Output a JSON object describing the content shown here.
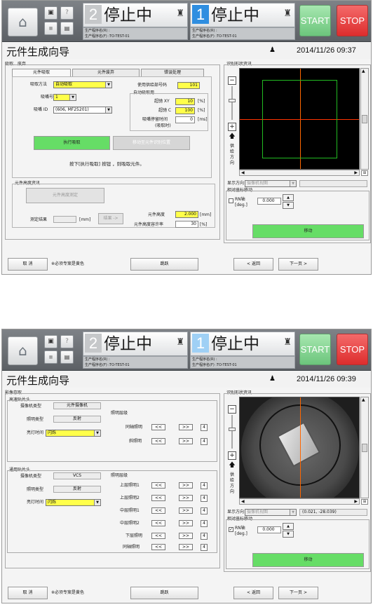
{
  "screens": [
    {
      "header": {
        "home_icon": "home-icon",
        "lane1": {
          "number": "2",
          "status": "停止中",
          "prog1": "生产程序名(R) :",
          "prog2": "生产程序名(F) :TO-TEST-01"
        },
        "lane2": {
          "number": "1",
          "status": "停止中",
          "prog1": "生产程序名(R) :",
          "prog2": "生产程序名(F) :TO-TEST-01"
        },
        "start": "START",
        "stop": "STOP",
        "colors": {
          "start": "#6cc57c",
          "stop": "#dd2d2d",
          "lane_active": "#2f8ee0"
        }
      },
      "title": "元件生成向导",
      "datetime": "2014/11/26 09:37",
      "group_title": "吸取、废弃",
      "tabs": [
        "元件吸取",
        "元件废弃",
        "错误处理"
      ],
      "pick_method_label": "吸取方法",
      "pick_method_value": "自动吸取",
      "nozzle_label": "吸嘴号",
      "nozzle_value": "1",
      "nozzle_id_label": "吸嘴 ID",
      "nozzle_id_value": "(606, MF25201)",
      "feeder_label": "使用供给部号码",
      "feeder_value": "101",
      "auto_label": "自动吸取用",
      "xy_label": "超驰 XY",
      "xy_value": "10",
      "xy_unit": "[%]",
      "c_label": "超驰 C",
      "c_value": "100",
      "c_unit": "[%]",
      "stop_label": "吸嘴停留时间",
      "stop_value": "0",
      "stop_unit": "[ms]",
      "stop_label2": "(吸取时)",
      "exec_button": "执行吸取",
      "move_button": "移动至元件识别位置",
      "hint": "按下[执行吸取] 按钮 ，则吸取元件。",
      "height_group": "元件高度资讯",
      "height_measure": "元件高度测定",
      "result_label": "测定结果",
      "result_unit": "[mm]",
      "result_button": "结果 ->",
      "height_label": "元件高度",
      "height_value": "2.000",
      "height_unit": "[mm]",
      "tol_label": "元件高度容许率",
      "tol_value": "30",
      "tol_unit": "[%]",
      "shape_group": "识别形状资讯",
      "feed_dir": "供给方向",
      "display_dir_label": "显示方向",
      "display_dir_value": "摄像机视图",
      "rel_move_group": "相对座标移动",
      "rn_axis": "RN轴",
      "rn_unit": "[deg.]",
      "rn_value": "0.000",
      "move_button2": "移动",
      "cancel": "取 消",
      "required_note": "※必须专案是黄色",
      "skip": "跳跃",
      "back": "< 返回",
      "next": "下一页 >"
    },
    {
      "header": {
        "home_icon": "home-icon",
        "lane1": {
          "number": "2",
          "status": "停止中",
          "prog1": "生产程序名(R) :",
          "prog2": "生产程序名(F) :TO-TEST-01"
        },
        "lane2": {
          "number": "1",
          "status": "停止中",
          "prog1": "生产程序名(R) :",
          "prog2": "生产程序名(F) :TO-TEST-01"
        },
        "start": "START",
        "stop": "STOP"
      },
      "title": "元件生成向导",
      "datetime": "2014/11/26 09:39",
      "group_title": "影像存取",
      "hp_group": "高速贴片头",
      "cam_type_label": "摄像机类型",
      "cam_type_value": "元件摄像机",
      "light_type_label": "照明类型",
      "light_type_value": "反射",
      "on_time_label": "亮灯时间",
      "on_time_value": "闪烁",
      "light_level_label": "照明层级",
      "hp_lights": [
        {
          "name": "同轴照明",
          "level": "4"
        },
        {
          "name": "斜照明",
          "level": "4"
        }
      ],
      "gen_group": "通用贴片头",
      "gen_cam_value": "VCS",
      "gen_light_value": "反射",
      "gen_lights": [
        {
          "name": "上层照明1",
          "level": "4"
        },
        {
          "name": "上层照明2",
          "level": "4"
        },
        {
          "name": "中层照明1",
          "level": "4"
        },
        {
          "name": "中层照明2",
          "level": "4"
        },
        {
          "name": "下层照明",
          "level": "4"
        },
        {
          "name": "同轴照明",
          "level": "4"
        }
      ],
      "dec": "<<",
      "inc": ">>",
      "shape_group": "识别形状资讯",
      "feed_dir": "供给方向",
      "display_dir_label": "显示方向",
      "display_dir_value": "摄像机视图",
      "coord": "(0.021, -28.039)",
      "rel_move_group": "相对座标移动",
      "rn_axis": "RN轴",
      "rn_unit": "[deg.]",
      "rn_value": "0.000",
      "move_button2": "移动",
      "cancel": "取 消",
      "required_note": "※必须专案是黄色",
      "skip": "跳跃",
      "back": "< 返回",
      "next": "下一页 >"
    }
  ]
}
